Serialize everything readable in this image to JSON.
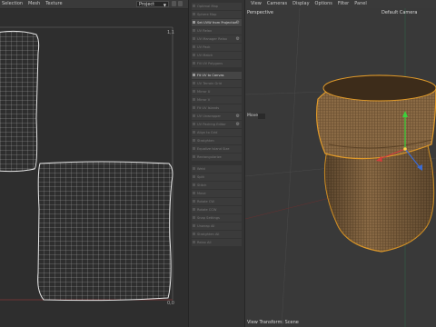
{
  "uv_editor": {
    "menu": [
      "Selection",
      "Mesh",
      "Texture"
    ],
    "dropdown": "Project",
    "label_top_right": "1,1",
    "label_bottom": "0,0"
  },
  "commands": {
    "items": [
      {
        "label": "Optimal Map",
        "active": false
      },
      {
        "label": "Sphere Map",
        "active": false
      },
      {
        "label": "Set UVW from Projection",
        "active": true,
        "gear": true
      },
      {
        "label": "UV Relax",
        "active": false
      },
      {
        "label": "UV Manager Relax",
        "active": false,
        "gear": true
      },
      {
        "label": "UV Pack",
        "active": false
      },
      {
        "label": "UV Match",
        "active": false
      },
      {
        "label": "Fill UV Polygons",
        "active": false
      },
      {
        "label": "Fit UV to Canvas",
        "active": true,
        "section": true
      },
      {
        "label": "UV Terrain Grid",
        "active": false
      },
      {
        "label": "Mirror U",
        "active": false
      },
      {
        "label": "Mirror V",
        "active": false
      },
      {
        "label": "Fit UV Islands",
        "active": false
      },
      {
        "label": "UV Unwrapper",
        "active": false,
        "gear": true
      },
      {
        "label": "UV Packing Editor",
        "active": false,
        "gear": true
      },
      {
        "label": "Align to Grid",
        "active": false
      },
      {
        "label": "Straighten",
        "active": false
      },
      {
        "label": "Equalize Island Size",
        "active": false
      },
      {
        "label": "Rectangularize",
        "active": false
      },
      {
        "label": "Weld",
        "active": false,
        "section": true
      },
      {
        "label": "Split",
        "active": false
      },
      {
        "label": "Stitch",
        "active": false
      },
      {
        "label": "Move",
        "active": false
      },
      {
        "label": "Rotate CW",
        "active": false
      },
      {
        "label": "Rotate CCW",
        "active": false
      },
      {
        "label": "Snap Settings",
        "active": false
      },
      {
        "label": "Unwrap All",
        "active": false
      },
      {
        "label": "Straighten All",
        "active": false
      },
      {
        "label": "Relax All",
        "active": false
      }
    ]
  },
  "viewport": {
    "menu": [
      "View",
      "Cameras",
      "Display",
      "Options",
      "Filter",
      "Panel"
    ],
    "view_name": "Perspective",
    "camera": "Default Camera",
    "tool_label": "Move",
    "status": "View Transform: Scene"
  },
  "colors": {
    "uv_line": "#d9d9d9",
    "axis_red": "#d23b3b",
    "axis_green": "#3bd23b",
    "axis_blue": "#3b6bd2",
    "bag": "#8a6a45",
    "selection": "#e09a2a"
  }
}
